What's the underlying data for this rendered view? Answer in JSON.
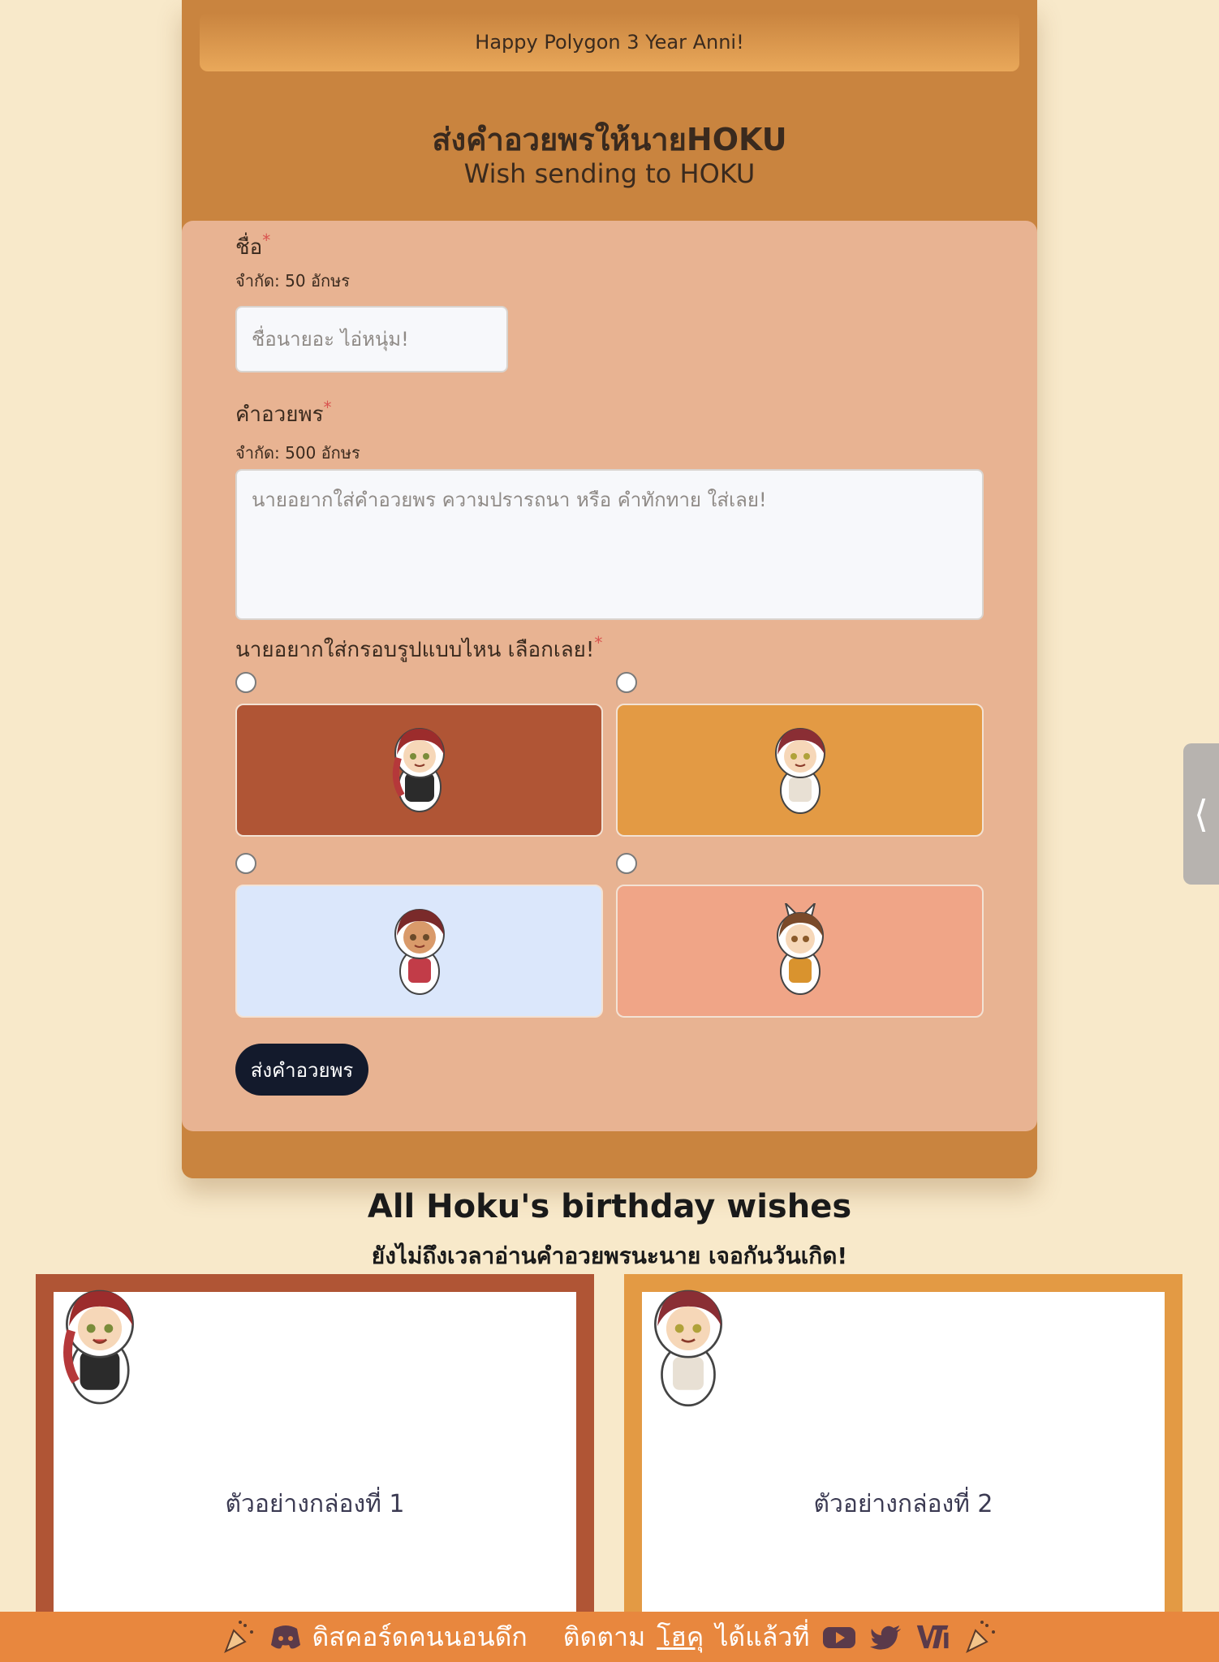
{
  "banner": "Happy Polygon 3 Year Anni!",
  "heading": {
    "thai": "ส่งคำอวยพรให้นายHOKU",
    "english": "Wish sending to HOKU"
  },
  "form": {
    "name_label": "ชื่อ",
    "name_required": "*",
    "name_hint": "จำกัด: 50 อักษร",
    "name_placeholder": "ชื่อนายอะ ไอ่หนุ่ม!",
    "wish_label": "คำอวยพร",
    "wish_required": "*",
    "wish_hint": "จำกัด: 500 อักษร",
    "wish_placeholder": "นายอยากใส่คำอวยพร ความปรารถนา หรือ คำทักทาย ใส่เลย!",
    "frame_label": "นายอยากใส่กรอบรูปแบบไหน เลือกเลย!",
    "frame_required": "*",
    "frames": [
      {
        "color": "#b05535"
      },
      {
        "color": "#e39a44"
      },
      {
        "color": "#dbe7fb"
      },
      {
        "color": "#f0a587"
      }
    ],
    "submit_label": "ส่งคำอวยพร"
  },
  "wishes": {
    "title": "All Hoku's birthday wishes",
    "subtitle": "ยังไม่ถึงเวลาอ่านคำอวยพรนะนาย เจอกันวันเกิด!",
    "boxes": [
      {
        "text": "ตัวอย่างกล่องที่ 1",
        "color": "#b05535"
      },
      {
        "text": "ตัวอย่างกล่องที่ 2",
        "color": "#e39a44"
      }
    ]
  },
  "footer": {
    "discord_text": "ดิสคอร์ดคนนอนดึก",
    "follow_prefix": "ติดตาม",
    "follow_link": "โฮคุ",
    "follow_suffix": "ได้แล้วที่",
    "icons": [
      "party-popper-icon",
      "discord-icon",
      "youtube-icon",
      "twitter-icon",
      "vti-logo-icon",
      "party-popper-icon"
    ]
  },
  "side_tab_icon": "chevron-left-icon"
}
